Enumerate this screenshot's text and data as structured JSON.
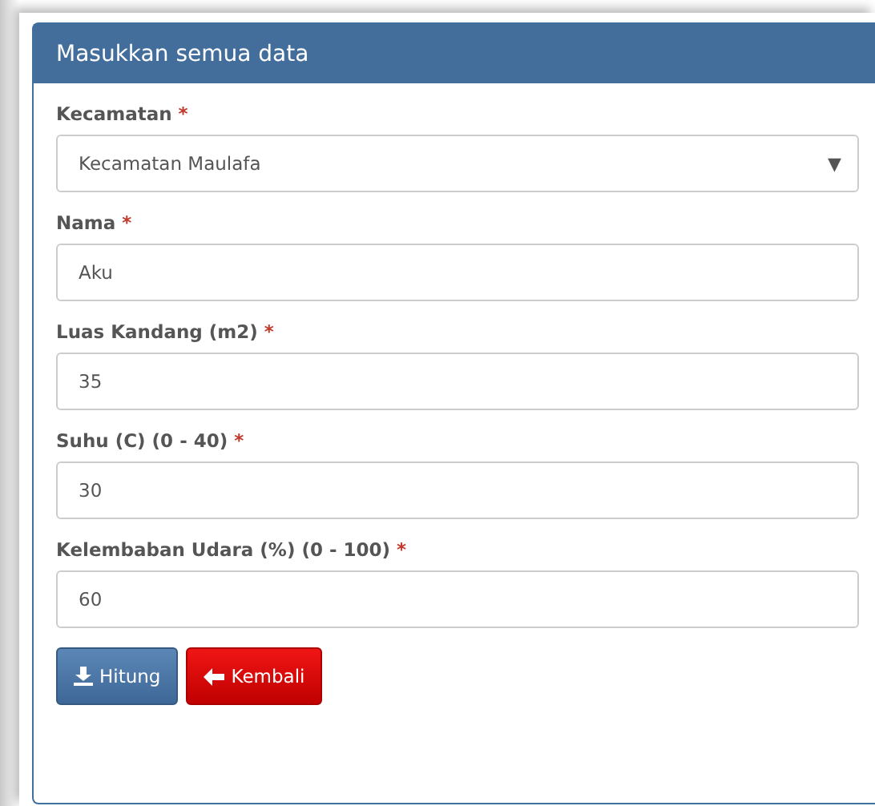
{
  "panel": {
    "title": "Masukkan semua data"
  },
  "fields": [
    {
      "kind": "select",
      "label": "Kecamatan",
      "required_mark": "*",
      "value": "Kecamatan Maulafa",
      "arrow": "▼"
    },
    {
      "kind": "input",
      "label": "Nama",
      "required_mark": "*",
      "value": "Aku"
    },
    {
      "kind": "input",
      "label": "Luas Kandang (m2)",
      "required_mark": "*",
      "value": "35"
    },
    {
      "kind": "input",
      "label": "Suhu (C) (0 - 40)",
      "required_mark": "*",
      "value": "30"
    },
    {
      "kind": "input",
      "label": "Kelembaban Udara (%) (0 - 100)",
      "required_mark": "*",
      "value": "60"
    }
  ],
  "buttons": [
    {
      "kind": "primary",
      "label": "Hitung"
    },
    {
      "kind": "danger",
      "label": "Kembali"
    }
  ]
}
